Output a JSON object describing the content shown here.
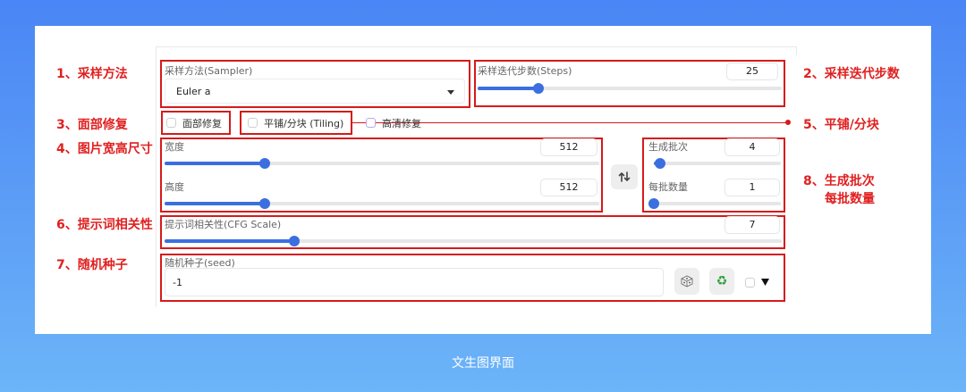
{
  "caption": "文生图界面",
  "annotations": {
    "a1": "1、采样方法",
    "a2": "2、采样迭代步数",
    "a3": "3、面部修复",
    "a4": "4、图片宽高尺寸",
    "a5": "5、平铺/分块",
    "a6": "6、提示词相关性",
    "a7": "7、随机种子",
    "a8_line1": "8、生成批次",
    "a8_line2": "每批数量"
  },
  "sampler": {
    "label": "采样方法(Sampler)",
    "value": "Euler a"
  },
  "steps": {
    "label": "采样迭代步数(Steps)",
    "value": "25",
    "fraction": 0.2
  },
  "checkboxes": {
    "face": "面部修复",
    "tiling": "平铺/分块 (Tiling)",
    "hires": "高清修复"
  },
  "width": {
    "label": "宽度",
    "value": "512",
    "fraction": 0.23
  },
  "height": {
    "label": "高度",
    "value": "512",
    "fraction": 0.23
  },
  "batch_count": {
    "label": "生成批次",
    "value": "4",
    "fraction": 0.05
  },
  "batch_size": {
    "label": "每批数量",
    "value": "1",
    "fraction": 0.0
  },
  "cfg": {
    "label": "提示词相关性(CFG Scale)",
    "value": "7",
    "fraction": 0.21
  },
  "seed": {
    "label": "随机种子(seed)",
    "value": "-1"
  },
  "colors": {
    "accent": "#3b6fe0",
    "annotation": "#e02020",
    "bg_top": "#4a86f5"
  }
}
